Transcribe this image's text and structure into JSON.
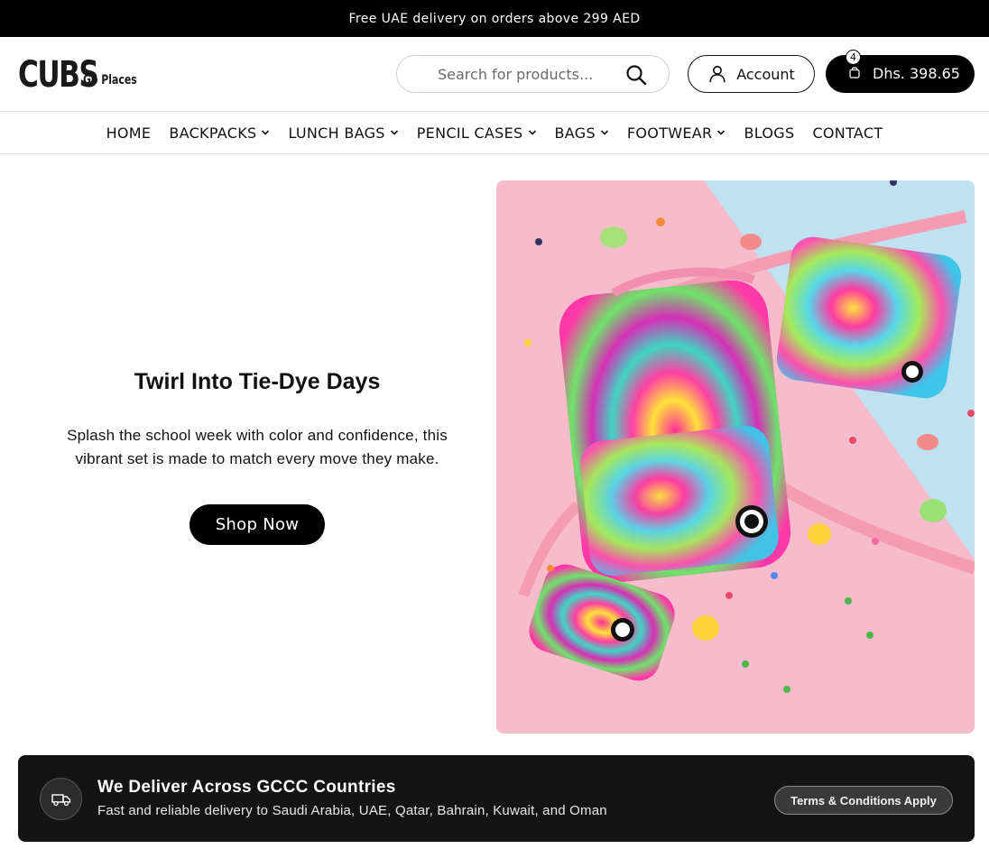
{
  "announcement": {
    "text": "Free UAE delivery on orders above 299 AED"
  },
  "logo": {
    "main": "CUBS",
    "sub": "Go Places"
  },
  "search": {
    "placeholder": "Search for products...",
    "icon": "search-icon"
  },
  "account": {
    "label": "Account",
    "icon": "user-icon"
  },
  "cart": {
    "count": "4",
    "amount": "Dhs. 398.65",
    "icon": "bag-icon"
  },
  "nav": {
    "items": [
      {
        "label": "HOME",
        "dropdown": false
      },
      {
        "label": "BACKPACKS",
        "dropdown": true
      },
      {
        "label": "LUNCH BAGS",
        "dropdown": true
      },
      {
        "label": "PENCIL CASES",
        "dropdown": true
      },
      {
        "label": "BAGS",
        "dropdown": true
      },
      {
        "label": "FOOTWEAR",
        "dropdown": true
      },
      {
        "label": "BLOGS",
        "dropdown": false
      },
      {
        "label": "CONTACT",
        "dropdown": false
      }
    ]
  },
  "hero": {
    "title": "Twirl Into Tie-Dye Days",
    "subtitle_line1": "Splash the school week with color and confidence, this",
    "subtitle_line2": "vibrant set is made to match every move they make.",
    "button": "Shop Now"
  },
  "delivery": {
    "title": "We Deliver Across GCCC Countries",
    "description": "Fast and reliable delivery to Saudi Arabia, UAE, Qatar, Bahrain, Kuwait, and Oman",
    "button": "Terms & Conditions Apply",
    "icon": "truck-icon"
  },
  "colors": {
    "primary": "#000000",
    "banner_bg": "#141414",
    "pink": "#f4b8c8",
    "blue": "#bde0ef"
  }
}
